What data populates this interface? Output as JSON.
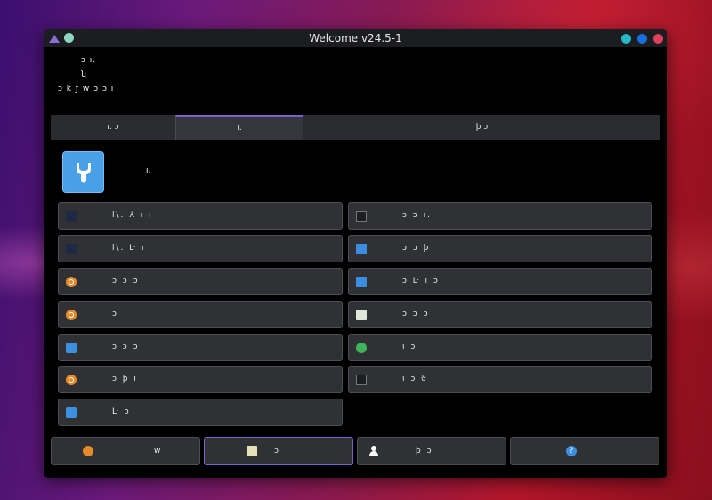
{
  "window": {
    "title": "Welcome v24.5-1"
  },
  "intro": {
    "line1": "ᴐ          ı.",
    "line2": "ʮ",
    "line3": "ᴐ       k       ƒ          w            ᴐ                   ᴐ              ı"
  },
  "tabs": [
    {
      "label": "ı.        ᴐ"
    },
    {
      "label": "ı."
    },
    {
      "label": "ϸ                                          ᴐ"
    }
  ],
  "page": {
    "title": "ı."
  },
  "left_buttons": [
    {
      "label": "l\\.      ⅄       ı          ı",
      "icon": "chart-icon"
    },
    {
      "label": "l\\.      ᒷ          ı",
      "icon": "chart-icon"
    },
    {
      "label": "ᴐ           ᴐ           ᴐ",
      "icon": "settings-orange-icon"
    },
    {
      "label": "ᴐ",
      "icon": "settings-orange-icon"
    },
    {
      "label": "ᴐ          ᴐ           ᴐ",
      "icon": "wrench-icon"
    },
    {
      "label": "ᴐ       ϸ           ı",
      "icon": "settings-orange-icon"
    },
    {
      "label": "ᒷ          ᴐ",
      "icon": "wrench-icon"
    }
  ],
  "right_buttons": [
    {
      "label": "ᴐ          ᴐ          ı.",
      "icon": "terminal-icon"
    },
    {
      "label": "ᴐ           ᴐ          ϸ",
      "icon": "screen-icon"
    },
    {
      "label": "ᴐ          ᒷ          ı              ᴐ",
      "icon": "screen-icon"
    },
    {
      "label": "ᴐ           ᴐ           ᴐ",
      "icon": "document-icon"
    },
    {
      "label": "ı             ᴐ",
      "icon": "gear-green-icon"
    },
    {
      "label": "ı         ᴐ          ϑ",
      "icon": "terminal-icon"
    }
  ],
  "bottom_buttons": [
    {
      "label": "w",
      "icon": "bolt-icon"
    },
    {
      "label": "ᴐ",
      "icon": "note-icon"
    },
    {
      "label": "ϸ        ᴐ",
      "icon": "person-icon"
    },
    {
      "label": "",
      "icon": "help-icon",
      "glyph": "?"
    }
  ]
}
